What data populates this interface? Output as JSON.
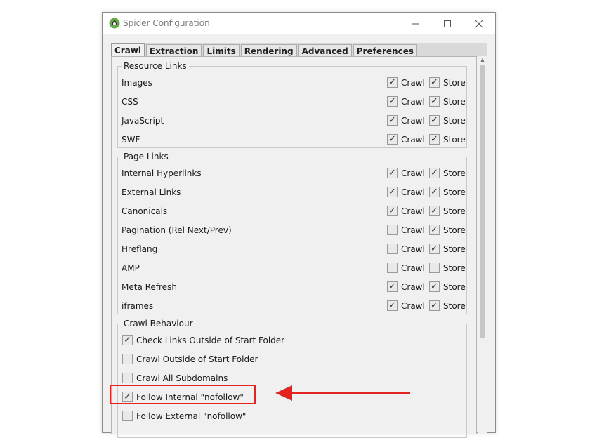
{
  "window": {
    "title": "Spider Configuration"
  },
  "tabs": [
    {
      "label": "Crawl",
      "active": true
    },
    {
      "label": "Extraction",
      "active": false
    },
    {
      "label": "Limits",
      "active": false
    },
    {
      "label": "Rendering",
      "active": false
    },
    {
      "label": "Advanced",
      "active": false
    },
    {
      "label": "Preferences",
      "active": false
    }
  ],
  "resource_links": {
    "legend": "Resource Links",
    "crawl_label": "Crawl",
    "store_label": "Store",
    "rows": [
      {
        "label": "Images",
        "crawl": true,
        "store": true
      },
      {
        "label": "CSS",
        "crawl": true,
        "store": true
      },
      {
        "label": "JavaScript",
        "crawl": true,
        "store": true
      },
      {
        "label": "SWF",
        "crawl": true,
        "store": true
      }
    ]
  },
  "page_links": {
    "legend": "Page Links",
    "crawl_label": "Crawl",
    "store_label": "Store",
    "rows": [
      {
        "label": "Internal Hyperlinks",
        "crawl": true,
        "store": true
      },
      {
        "label": "External Links",
        "crawl": true,
        "store": true
      },
      {
        "label": "Canonicals",
        "crawl": true,
        "store": true
      },
      {
        "label": "Pagination (Rel Next/Prev)",
        "crawl": false,
        "store": true
      },
      {
        "label": "Hreflang",
        "crawl": false,
        "store": true
      },
      {
        "label": "AMP",
        "crawl": false,
        "store": false
      },
      {
        "label": "Meta Refresh",
        "crawl": true,
        "store": true
      },
      {
        "label": "iframes",
        "crawl": true,
        "store": true
      }
    ]
  },
  "crawl_behaviour": {
    "legend": "Crawl Behaviour",
    "rows": [
      {
        "label": "Check Links Outside of Start Folder",
        "checked": true
      },
      {
        "label": "Crawl Outside of Start Folder",
        "checked": false
      },
      {
        "label": "Crawl All Subdomains",
        "checked": false
      },
      {
        "label": "Follow Internal \"nofollow\"",
        "checked": true
      },
      {
        "label": "Follow External \"nofollow\"",
        "checked": false
      }
    ]
  },
  "colors": {
    "highlight": "#e32222",
    "window_bg": "#f0f0f0"
  },
  "icons": {
    "app": "spider-logo-icon",
    "minimize": "minimize-icon",
    "maximize": "maximize-icon",
    "close": "close-icon"
  }
}
